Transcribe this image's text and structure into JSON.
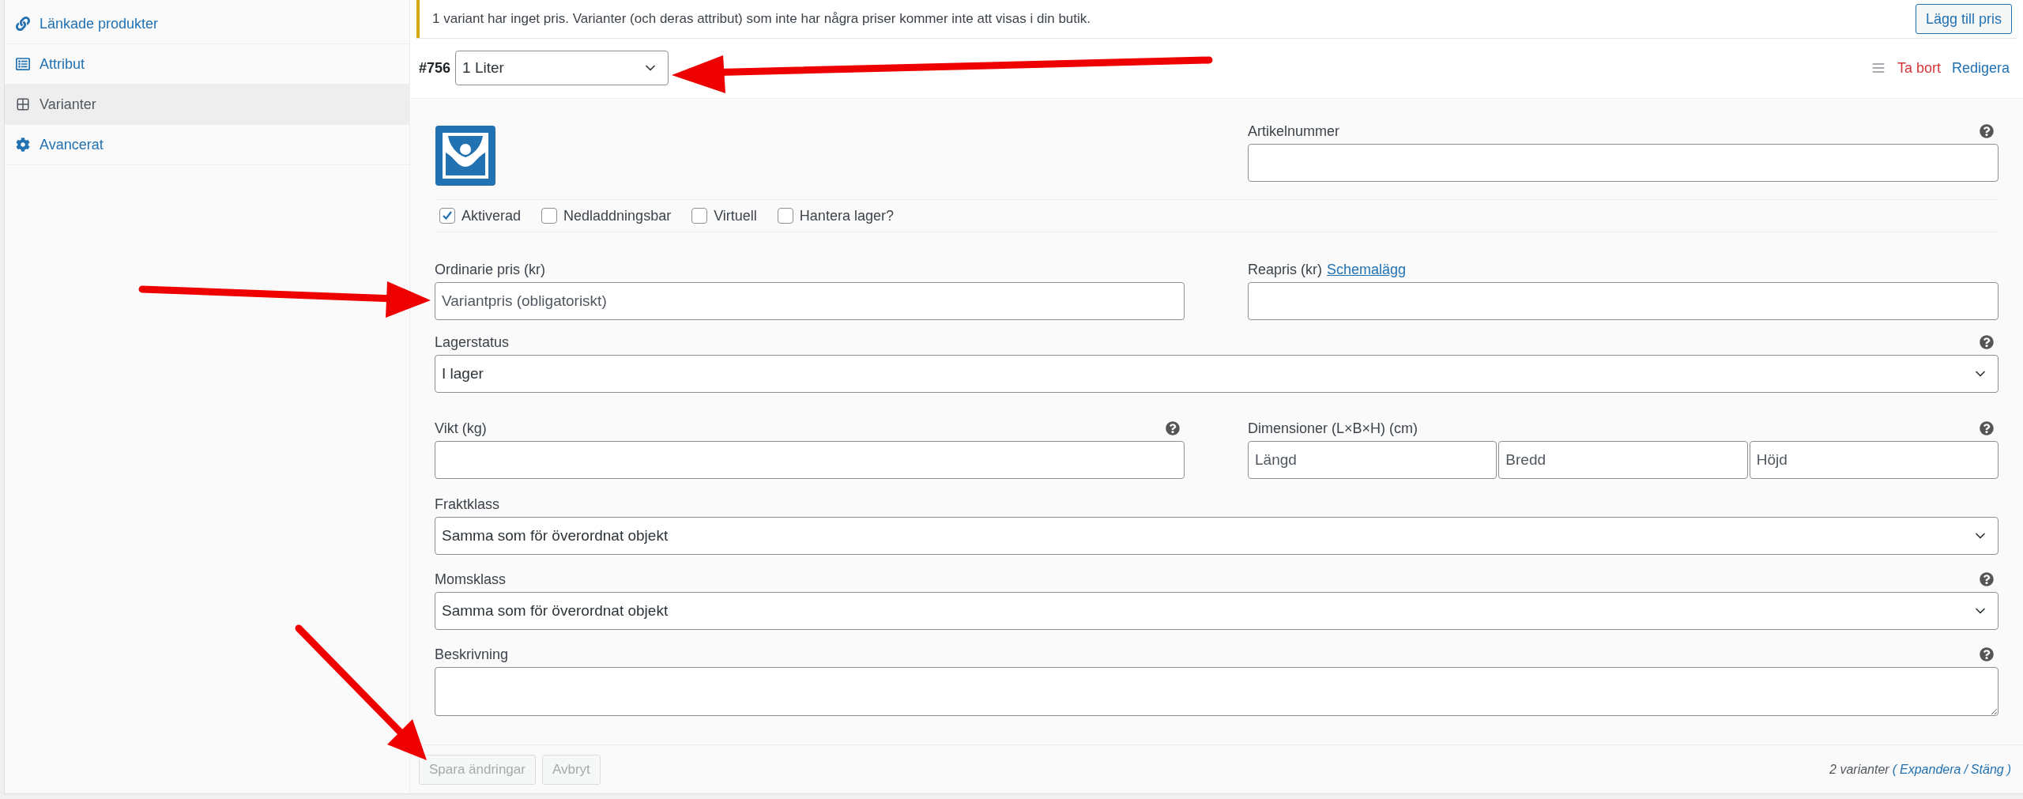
{
  "sidebar": {
    "items": [
      {
        "label": "Länkade produkter",
        "kind": "link",
        "selected": false
      },
      {
        "label": "Attribut",
        "kind": "list",
        "selected": false
      },
      {
        "label": "Varianter",
        "kind": "grid",
        "selected": true
      },
      {
        "label": "Avancerat",
        "kind": "gear",
        "selected": false
      }
    ]
  },
  "notice": {
    "text": "1 variant har inget pris. Varianter (och deras attribut) som inte har några priser kommer inte att visas i din butik.",
    "button": "Lägg till pris"
  },
  "variant": {
    "number": "#756",
    "attribute": "1 Liter",
    "delete": "Ta bort",
    "edit": "Redigera"
  },
  "sku": {
    "label": "Artikelnummer"
  },
  "checkboxes": [
    {
      "label": "Aktiverad",
      "checked": true
    },
    {
      "label": "Nedladdningsbar",
      "checked": false
    },
    {
      "label": "Virtuell",
      "checked": false
    },
    {
      "label": "Hantera lager?",
      "checked": false
    }
  ],
  "regular_price": {
    "label": "Ordinarie pris (kr)",
    "placeholder": "Variantpris (obligatoriskt)"
  },
  "sale_price": {
    "label": "Reapris (kr)",
    "link": "Schemalägg"
  },
  "stock_status": {
    "label": "Lagerstatus",
    "value": "I lager"
  },
  "weight": {
    "label": "Vikt (kg)"
  },
  "dimensions": {
    "label": "Dimensioner (L×B×H) (cm)",
    "placeholders": [
      "Längd",
      "Bredd",
      "Höjd"
    ]
  },
  "shipping_class": {
    "label": "Fraktklass",
    "value": "Samma som för överordnat objekt"
  },
  "tax_class": {
    "label": "Momsklass",
    "value": "Samma som för överordnat objekt"
  },
  "description": {
    "label": "Beskrivning"
  },
  "footer": {
    "save": "Spara ändringar",
    "cancel": "Avbryt",
    "count": "2 varianter",
    "open_paren": "(",
    "separator": "/",
    "close_paren": ")",
    "expand": "Expandera",
    "close": "Stäng"
  }
}
